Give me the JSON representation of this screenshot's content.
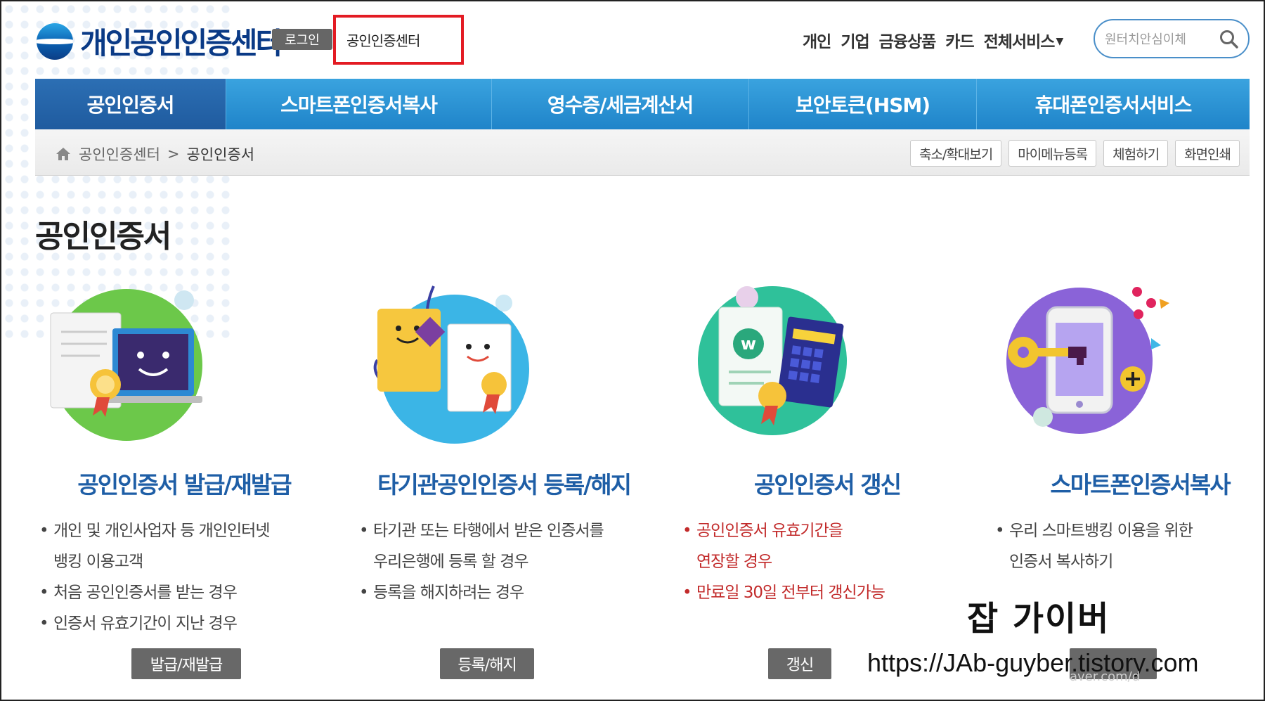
{
  "header": {
    "logo_text": "개인공인인증센터",
    "login_label": "로그인",
    "highlight_text": "공인인증센터",
    "top_links": [
      "개인",
      "기업",
      "금융상품",
      "카드"
    ],
    "all_services_label": "전체서비스",
    "search_placeholder": "원터치안심이체"
  },
  "main_nav": {
    "tabs": [
      {
        "label": "공인인증서"
      },
      {
        "label": "스마트폰인증서복사"
      },
      {
        "label": "영수증/세금계산서"
      },
      {
        "label": "보안토큰(HSM)"
      },
      {
        "label": "휴대폰인증서서비스"
      }
    ]
  },
  "breadcrumb": {
    "items": [
      "공인인증센터",
      "공인인증서"
    ],
    "separator": ">"
  },
  "tools": {
    "zoom": "축소/확대보기",
    "my_menu": "마이메뉴등록",
    "experience": "체험하기",
    "print": "화면인쇄"
  },
  "page_title": "공인인증서",
  "services": [
    {
      "title": "공인인증서 발급/재발급",
      "bullets": [
        [
          "개인 및 개인사업자 등 개인인터넷",
          "뱅킹 이용고객"
        ],
        [
          "처음 공인인증서를 받는 경우"
        ],
        [
          "인증서 유효기간이 지난 경우"
        ]
      ],
      "button": "발급/재발급"
    },
    {
      "title": "타기관공인인증서 등록/해지",
      "bullets": [
        [
          "타기관 또는 타행에서 받은 인증서를",
          "우리은행에 등록 할 경우"
        ],
        [
          "등록을 해지하려는 경우"
        ]
      ],
      "button": "등록/해지"
    },
    {
      "title": "공인인증서 갱신",
      "bullets": [
        [
          "공인인증서 유효기간을",
          "연장할 경우"
        ],
        [
          "만료일 30일 전부터 갱신가능"
        ]
      ],
      "button": "갱신"
    },
    {
      "title": "스마트폰인증서복사",
      "bullets": [
        [
          "우리 스마트뱅킹 이용을 위한",
          "인증서 복사하기"
        ]
      ],
      "button": ""
    }
  ],
  "bullet_mark": "•",
  "watermark": {
    "title": "잡 가이버",
    "url": "https://JAb-guyber.tistory.com",
    "ghost": "aver.com/d"
  },
  "colors": {
    "nav_blue": "#1f84c9",
    "nav_active": "#1f5b9f",
    "title_blue": "#1e5ea6",
    "highlight_red": "#e31b23",
    "warning_red": "#c22a2a"
  }
}
